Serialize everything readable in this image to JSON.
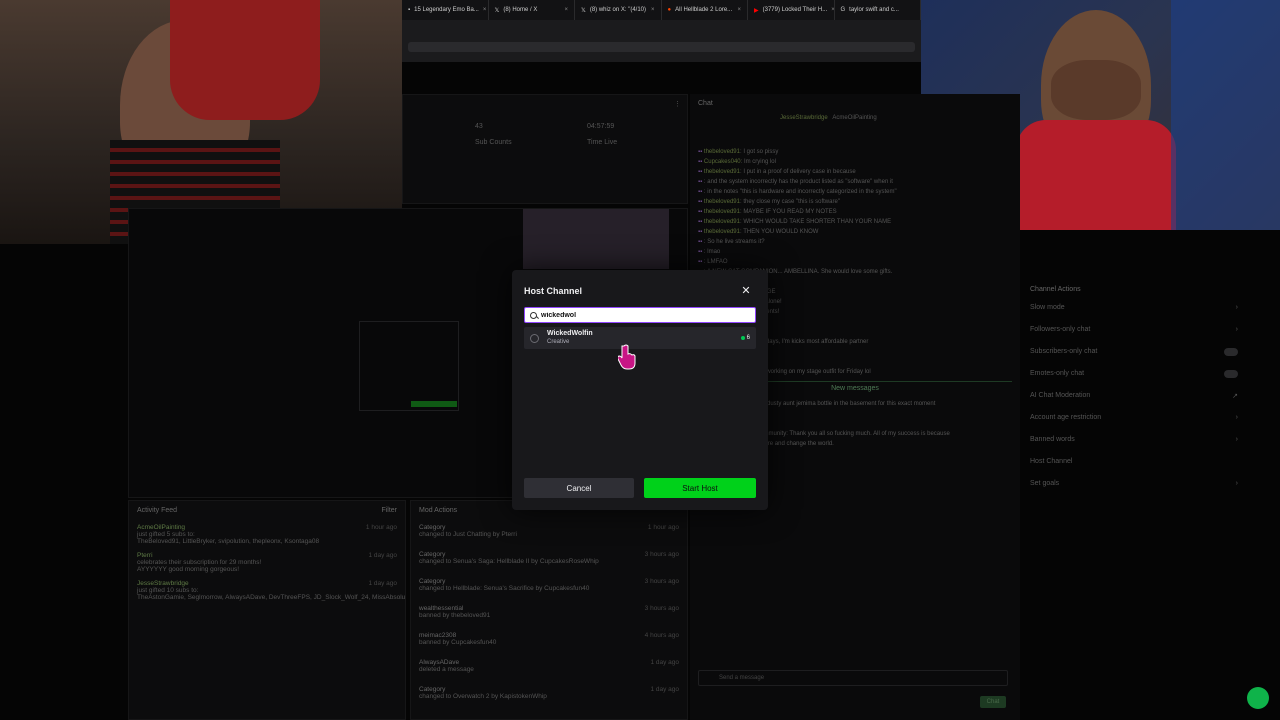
{
  "browser": {
    "tabs": [
      {
        "icon": "page-icon",
        "title": "15 Legendary Emo Ba..."
      },
      {
        "icon": "x-logo-icon",
        "title": "(8) Home / X"
      },
      {
        "icon": "x-logo-icon",
        "title": "(8) whiz on X: \"(4/10)"
      },
      {
        "icon": "reddit-icon",
        "title": "All Hellblade 2 Lore..."
      },
      {
        "icon": "youtube-icon",
        "title": "(3779) Locked Their H..."
      },
      {
        "icon": "google-icon",
        "title": "taylor swift and c..."
      }
    ]
  },
  "dashboard": {
    "stats": {
      "sub_count_value": "43",
      "sub_count_label": "Sub Counts",
      "time_live_value": "04:57:59",
      "time_live_label": "Time Live"
    },
    "chat_title": "Chat",
    "chat_pinned_user": "JesseStrawbridge",
    "chat_pinned_other": "AcmeOilPainting",
    "chat_lines": [
      {
        "user": "thebeloved91",
        "text": "I got so pissy"
      },
      {
        "user": "Cupcakes040",
        "text": "Im crying lol"
      },
      {
        "user": "thebeloved91",
        "text": "I put in a proof of delivery case in because"
      },
      {
        "user": "",
        "text": "and the system incorrectly has the product listed as \"software\" when it"
      },
      {
        "user": "",
        "text": "in the notes \"this is hardware and incorrectly categorized in the system\""
      },
      {
        "user": "thebeloved91",
        "text": "they close my case \"this is software\""
      },
      {
        "user": "thebeloved91",
        "text": "MAYBE IF YOU READ MY NOTES"
      },
      {
        "user": "thebeloved91",
        "text": "WHICH WOULD TAKE SHORTER THAN YOUR NAME"
      },
      {
        "user": "thebeloved91",
        "text": "THEN YOU WOULD KNOW"
      },
      {
        "user": "",
        "text": "So he live streams it?"
      },
      {
        "user": "",
        "text": "lmao"
      },
      {
        "user": "",
        "text": "LMFAO"
      },
      {
        "user": "",
        "text": "A NEW CAT COMPANION... AMBELLINA. She would love some gifts."
      },
      {
        "user": "",
        "text": "Oh fock feces"
      },
      {
        "user": "",
        "text": "HEY GET OFF MY PAGE"
      },
      {
        "user": "",
        "text": "Leave my 16 viewers alone!"
      },
      {
        "user": "",
        "text": "Lemme make my 40 cents!"
      },
      {
        "user": "",
        "text": "pfff god no"
      },
      {
        "user": "",
        "text": "Im working lmao"
      },
      {
        "user": "",
        "text": "I had no internet for 7 days, I'm kicks most affordable partner"
      },
      {
        "user": "Cupcakes040",
        "text": "Widdling"
      },
      {
        "user": "Cupcakes040",
        "text": "lmao"
      },
      {
        "user": "Cupcakes040",
        "text": "Actually working on my stage outfit for Friday lol"
      }
    ],
    "new_messages_label": "New messages",
    "chat_lines_after": [
      {
        "user": "Cupcakes040",
        "text": "I have a dusty aunt jemima bottle in the basement for this exact moment"
      },
      {
        "user": "AlwaysADave",
        "text": ""
      },
      {
        "user": "AlwaysADave",
        "text": ""
      },
      {
        "user": "BoWiz",
        "text": "To all of our community: Thank you all so fucking much. All of my success is because"
      },
      {
        "user": "",
        "text": "of you. Let's go out there and change the world."
      }
    ],
    "chat_input_placeholder": "Send a message",
    "chat_button": "Chat",
    "channel_actions_title": "Channel Actions",
    "channel_actions": [
      {
        "label": "Slow mode",
        "kind": "chevron"
      },
      {
        "label": "Followers-only chat",
        "kind": "chevron"
      },
      {
        "label": "Subscribers-only chat",
        "kind": "toggle"
      },
      {
        "label": "Emotes-only chat",
        "kind": "toggle"
      },
      {
        "label": "AI Chat Moderation",
        "kind": "external"
      },
      {
        "label": "Account age restriction",
        "kind": "chevron"
      },
      {
        "label": "Banned words",
        "kind": "chevron"
      },
      {
        "label": "Host Channel",
        "kind": "none"
      },
      {
        "label": "Set goals",
        "kind": "chevron"
      }
    ],
    "activity_feed": {
      "title": "Activity Feed",
      "filter_label": "Filter",
      "items": [
        {
          "name": "AcmeOilPainting",
          "detail": "just gifted 5 subs to:",
          "extra": "TheBeloved91, LittleBryker, svipolution, thepleonx, Ksontaga08",
          "time": "1 hour ago"
        },
        {
          "name": "Pterri",
          "detail": "celebrates their subscription for 29 months!",
          "extra": "AYYYYYY good morning gorgeous!",
          "time": "1 day ago"
        },
        {
          "name": "JesseStrawbridge",
          "detail": "just gifted 10 subs to:",
          "extra": "TheAstonGamie, Seglmorrow, AlwaysADave, DevThreeFPS, JD_Slock_Wolf_24, MissAbsolution, bryantskyrt, Kzredanim, wimmeladies, Oblisamity",
          "time": "1 day ago"
        }
      ]
    },
    "mod_actions": {
      "title": "Mod Actions",
      "items": [
        {
          "name": "Category",
          "detail": "changed to Just Chatting by Pterri",
          "time": "1 hour ago"
        },
        {
          "name": "Category",
          "detail": "changed to Senua's Saga: Hellblade II by CupcakesRoseWhip",
          "time": "3 hours ago"
        },
        {
          "name": "Category",
          "detail": "changed to Hellblade: Senua's Sacrifice by Cupcakesfun40",
          "time": "3 hours ago"
        },
        {
          "name": "wealthessential",
          "detail": "banned by thebeloved91",
          "time": "3 hours ago"
        },
        {
          "name": "meimac2308",
          "detail": "banned by Cupcakesfun40",
          "time": "4 hours ago"
        },
        {
          "name": "AlwaysADave",
          "detail": "deleted a message",
          "time": "1 day ago"
        },
        {
          "name": "Category",
          "detail": "changed to Overwatch 2 by KapistokenWhip",
          "time": "1 day ago"
        }
      ]
    }
  },
  "modal": {
    "title": "Host Channel",
    "close_icon": "close-icon",
    "search_value": "wickedwol",
    "search_icon": "search-icon",
    "result": {
      "name": "WickedWolfin",
      "category": "Creative",
      "viewers": "6"
    },
    "cancel_label": "Cancel",
    "start_label": "Start Host"
  },
  "colors": {
    "accent": "#9147ff",
    "start_button": "#00d11a",
    "live_dot": "#00c853",
    "modal_bg": "#18181b"
  }
}
